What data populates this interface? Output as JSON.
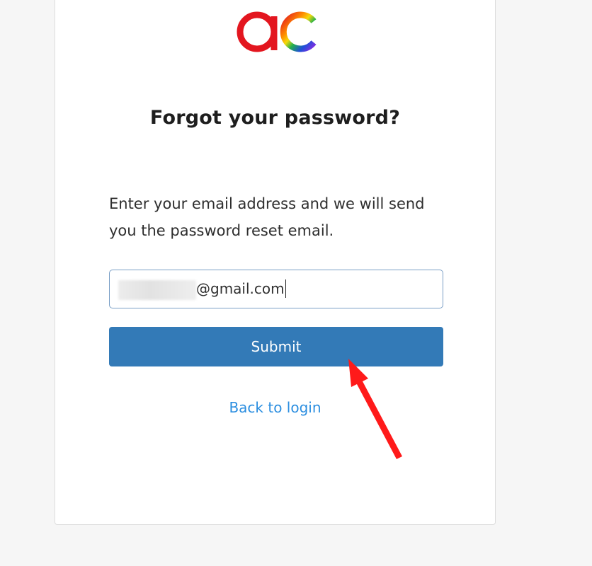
{
  "form": {
    "title": "Forgot your password?",
    "description": "Enter your email address and we will send you the password reset email.",
    "email_value": "@gmail.com",
    "submit_label": "Submit",
    "back_link": "Back to login"
  },
  "logo": {
    "text": "ac",
    "colors": [
      "#e3161f",
      "#ff8a00",
      "#f5d90a",
      "#22b14c",
      "#1e4fd8",
      "#8a2be2"
    ]
  },
  "colors": {
    "primary_button": "#337ab7",
    "link": "#2b8ee0",
    "annotation_arrow": "#ff1a1a"
  },
  "annotation": {
    "icon": "red-arrow-icon"
  }
}
